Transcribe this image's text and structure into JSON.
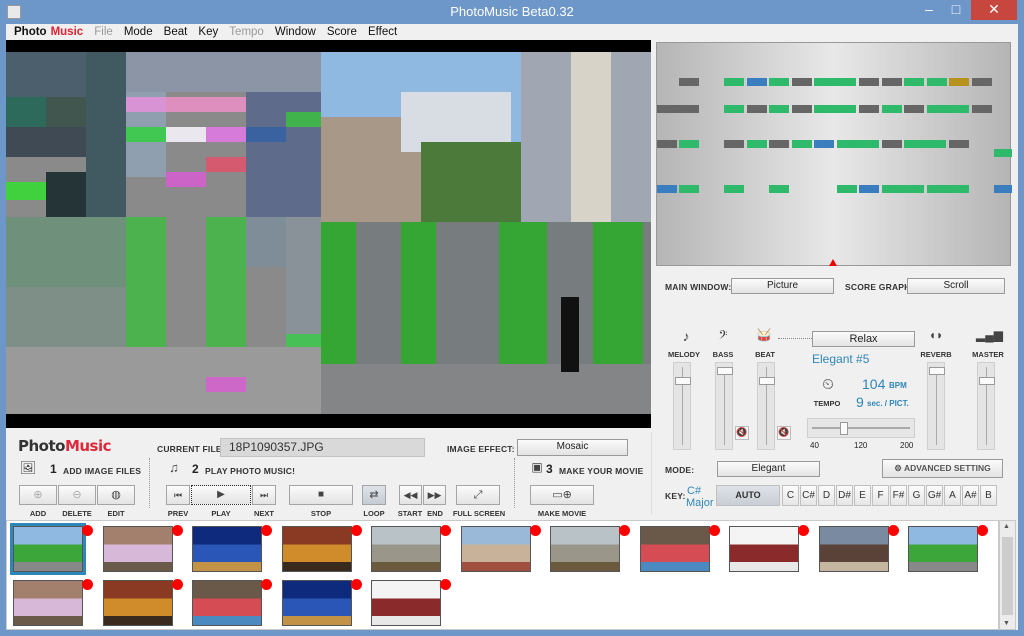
{
  "window": {
    "title": "PhotoMusic Beta0.32",
    "min": "–",
    "max": "□",
    "close": "✕"
  },
  "menu": {
    "logo_a": "Photo",
    "logo_b": "Music",
    "items": [
      "File",
      "Mode",
      "Beat",
      "Key",
      "Tempo",
      "Window",
      "Score",
      "Effect"
    ],
    "disabled": [
      "File",
      "Tempo"
    ]
  },
  "settings": {
    "main_window_label": "MAIN WINDOW:",
    "main_window_value": "Picture",
    "score_graph_label": "SCORE GRAPH:",
    "score_graph_value": "Scroll"
  },
  "mixer": {
    "melody": "MELODY",
    "bass": "BASS",
    "beat": "BEAT",
    "reverb": "REVERB",
    "master": "MASTER",
    "style": "Relax",
    "preset": "Elegant #5",
    "tempo_label": "TEMPO",
    "bpm_value": "104",
    "bpm_unit": "BPM",
    "sec_value": "9",
    "sec_unit": "sec. / PICT.",
    "slider_min": "40",
    "slider_mid": "120",
    "slider_max": "200",
    "tempo_fraction": 0.3
  },
  "mode": {
    "label": "MODE:",
    "value": "Elegant",
    "advanced": "ADVANCED SETTING"
  },
  "key": {
    "label": "KEY:",
    "current_a": "C#",
    "current_b": "Major",
    "auto": "AUTO",
    "notes": [
      "C",
      "C#",
      "D",
      "D#",
      "E",
      "F",
      "F#",
      "G",
      "G#",
      "A",
      "A#",
      "B"
    ]
  },
  "controls": {
    "logo_a": "Photo",
    "logo_b": "Music",
    "current_file_label": "CURRENT FILE:",
    "current_file": "18P1090357.JPG",
    "image_effect_label": "IMAGE EFFECT:",
    "image_effect": "Mosaic",
    "step1_num": "1",
    "step1": "ADD IMAGE FILES",
    "step2_num": "2",
    "step2": "PLAY PHOTO MUSIC!",
    "step3_num": "3",
    "step3": "MAKE YOUR MOVIE",
    "add": "ADD",
    "delete": "DELETE",
    "edit": "EDIT",
    "prev": "PREV",
    "play": "PLAY",
    "next": "NEXT",
    "stop": "STOP",
    "loop": "LOOP",
    "start": "START",
    "end": "END",
    "full_screen": "FULL SCREEN",
    "make_movie": "MAKE MOVIE"
  },
  "colors": {
    "accent": "#2f86b8",
    "green": "#2fba6b",
    "blue": "#3a7ec0",
    "mustard": "#b8921e",
    "record_dot": "#ff0000",
    "logo_red": "#e0283a"
  },
  "thumbnails": [
    {
      "subject": "green-fence-street"
    },
    {
      "subject": "flower-hats"
    },
    {
      "subject": "night-city-blue"
    },
    {
      "subject": "book-shelves"
    },
    {
      "subject": "coastal-sky"
    },
    {
      "subject": "old-buildings"
    },
    {
      "subject": "coastal-sky"
    },
    {
      "subject": "balloons-market"
    },
    {
      "subject": "tower-interior"
    },
    {
      "subject": "old-buildings-dark"
    },
    {
      "subject": "green-fence-street"
    },
    {
      "subject": "flower-hats"
    },
    {
      "subject": "book-shelves"
    },
    {
      "subject": "balloons-market"
    },
    {
      "subject": "night-city-blue"
    },
    {
      "subject": "tower-interior"
    }
  ]
}
